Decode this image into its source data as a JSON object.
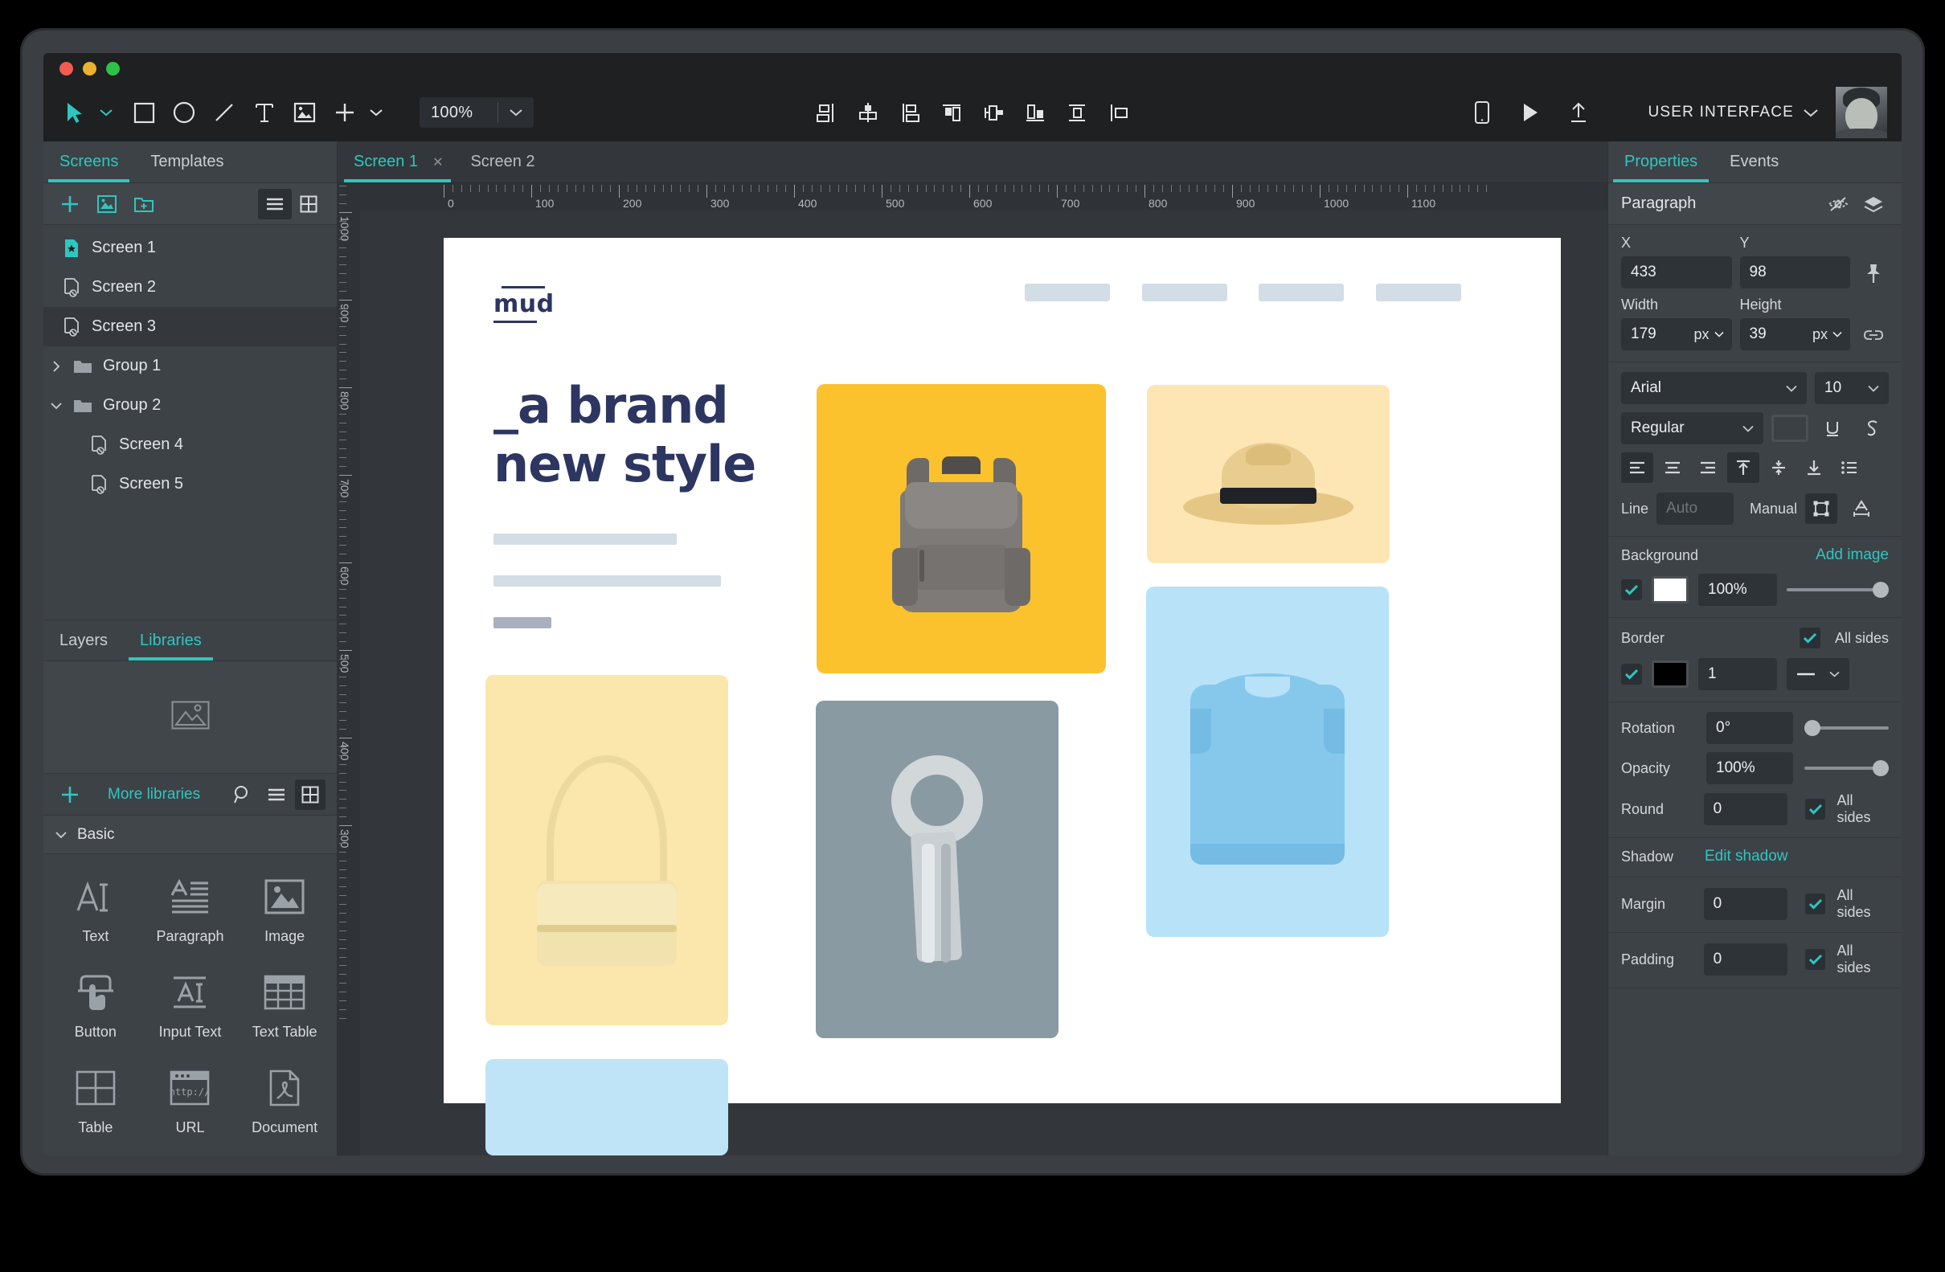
{
  "window": {
    "traffic_lights": [
      "close",
      "minimize",
      "maximize"
    ]
  },
  "toolbar": {
    "tools": [
      {
        "name": "select-tool",
        "icon": "cursor-arrow"
      },
      {
        "name": "rectangle-tool",
        "icon": "square"
      },
      {
        "name": "ellipse-tool",
        "icon": "circle"
      },
      {
        "name": "line-tool",
        "icon": "line"
      },
      {
        "name": "text-tool",
        "icon": "text-T"
      },
      {
        "name": "image-tool",
        "icon": "image"
      },
      {
        "name": "add-tool",
        "icon": "plus"
      }
    ],
    "zoom_value": "100%",
    "align_tools": [
      "align-left",
      "align-center-horizontal",
      "align-right",
      "align-top",
      "distribute-horizontal",
      "align-bottom",
      "align-middle-vertical",
      "distribute-vertical"
    ],
    "preview_device_icon": "mobile",
    "play_icon": "play",
    "share_icon": "upload",
    "mode_label": "USER INTERFACE",
    "mode_chevron": "chevron-down",
    "avatar": "user-avatar"
  },
  "left_panel": {
    "tabs": [
      {
        "label": "Screens",
        "active": true
      },
      {
        "label": "Templates",
        "active": false
      }
    ],
    "toolbar_icons": [
      "add-screen",
      "add-image-screen",
      "add-folder"
    ],
    "view_list_icon": "list-view",
    "view_grid_icon": "grid-view",
    "screens": [
      {
        "label": "Screen 1",
        "icon": "screen-home",
        "type": "screen",
        "selected": false,
        "indent": false
      },
      {
        "label": "Screen 2",
        "icon": "screen-file",
        "type": "screen",
        "selected": false,
        "indent": false
      },
      {
        "label": "Screen 3",
        "icon": "screen-file",
        "type": "screen",
        "selected": true,
        "indent": false
      },
      {
        "label": "Group 1",
        "icon": "folder",
        "type": "group",
        "expanded": false,
        "selected": false,
        "indent": false
      },
      {
        "label": "Group 2",
        "icon": "folder",
        "type": "group",
        "expanded": true,
        "selected": false,
        "indent": false
      },
      {
        "label": "Screen 4",
        "icon": "screen-file",
        "type": "screen",
        "selected": false,
        "indent": true
      },
      {
        "label": "Screen 5",
        "icon": "screen-file",
        "type": "screen",
        "selected": false,
        "indent": true
      }
    ],
    "lower_tabs": [
      {
        "label": "Layers",
        "active": false
      },
      {
        "label": "Libraries",
        "active": true
      }
    ],
    "library_preview_icon": "image-placeholder",
    "library_bar": {
      "add_icon": "plus",
      "more_label": "More libraries",
      "search_icon": "search",
      "list_icon": "list-view",
      "grid_icon": "grid-view"
    },
    "category": {
      "label": "Basic",
      "expanded": true
    },
    "components": [
      {
        "label": "Text",
        "icon": "text-AI"
      },
      {
        "label": "Paragraph",
        "icon": "paragraph"
      },
      {
        "label": "Image",
        "icon": "image"
      },
      {
        "label": "Button",
        "icon": "button-click"
      },
      {
        "label": "Input Text",
        "icon": "input-text"
      },
      {
        "label": "Text Table",
        "icon": "text-table"
      },
      {
        "label": "Table",
        "icon": "table"
      },
      {
        "label": "URL",
        "icon": "url-browser"
      },
      {
        "label": "Document",
        "icon": "document-pdf"
      }
    ]
  },
  "canvas": {
    "tabs": [
      {
        "label": "Screen 1",
        "active": true,
        "closable": true
      },
      {
        "label": "Screen 2",
        "active": false,
        "closable": false
      }
    ],
    "h_ruler_labels": [
      "0",
      "100",
      "200",
      "300",
      "400",
      "500",
      "600",
      "700",
      "800",
      "900",
      "1000",
      "1100"
    ],
    "v_ruler_labels": [
      "1000",
      "900",
      "800",
      "700",
      "600",
      "500",
      "400",
      "300"
    ],
    "design": {
      "logo_text": "mud",
      "nav_items": 4,
      "headline_line1": "_a brand",
      "headline_line2": "new style",
      "headline_color": "#2d3561",
      "tiles": [
        {
          "name": "backpack",
          "bg": "#fbc22d"
        },
        {
          "name": "hat",
          "bg": "#fde6b4"
        },
        {
          "name": "handbag",
          "bg": "#fbe6ab"
        },
        {
          "name": "shirt",
          "bg": "#b7e2f8"
        },
        {
          "name": "scarf",
          "bg": "#8a9aa3"
        },
        {
          "name": "blue-tile",
          "bg": "#bfe4f8"
        }
      ]
    }
  },
  "properties": {
    "tabs": [
      {
        "label": "Properties",
        "active": true
      },
      {
        "label": "Events",
        "active": false
      }
    ],
    "selection_title": "Paragraph",
    "header_icons": [
      "hide-eye",
      "layers"
    ],
    "geometry": {
      "x_label": "X",
      "x_value": "433",
      "y_label": "Y",
      "y_value": "98",
      "width_label": "Width",
      "width_value": "179",
      "width_unit": "px",
      "height_label": "Height",
      "height_value": "39",
      "height_unit": "px",
      "pin_icon": "pin",
      "link_icon": "link"
    },
    "typography": {
      "font_family": "Arial",
      "font_size": "10",
      "font_weight": "Regular",
      "color_swatch": "#3b4044",
      "underline_icon": "underline",
      "strikethrough_icon": "strikethrough",
      "align_icons": [
        "align-left",
        "align-center",
        "align-right"
      ],
      "valign_icons": [
        "valign-top",
        "valign-middle",
        "valign-bottom"
      ],
      "list_icon": "bullet-list",
      "line_label": "Line",
      "line_placeholder": "Auto",
      "manual_label": "Manual",
      "manual_icon": "bounding-box",
      "letterspacing_icon": "letter-spacing"
    },
    "background": {
      "label": "Background",
      "add_image_label": "Add image",
      "enabled": true,
      "color": "#ffffff",
      "opacity": "100%",
      "opacity_slider_pct": 100
    },
    "border": {
      "label": "Border",
      "all_sides_label": "All sides",
      "all_sides_checked": true,
      "enabled": true,
      "color": "#000000",
      "width": "1",
      "style": "solid"
    },
    "transform": {
      "rotation_label": "Rotation",
      "rotation_value": "0°",
      "rotation_slider_pct": 0,
      "opacity_label": "Opacity",
      "opacity_value": "100%",
      "opacity_slider_pct": 100,
      "round_label": "Round",
      "round_value": "0",
      "round_all_sides_label": "All sides",
      "round_all_sides_checked": true
    },
    "shadow": {
      "label": "Shadow",
      "edit_label": "Edit shadow"
    },
    "margin": {
      "label": "Margin",
      "value": "0",
      "all_sides_label": "All sides",
      "all_sides_checked": true
    },
    "padding": {
      "label": "Padding",
      "value": "0",
      "all_sides_label": "All sides",
      "all_sides_checked": true
    }
  },
  "colors": {
    "accent": "#2ec7c0",
    "panel_bg": "#3d4247",
    "toolbar_bg": "#1e2021",
    "canvas_bg": "#33373b",
    "field_bg": "#2e3338"
  }
}
